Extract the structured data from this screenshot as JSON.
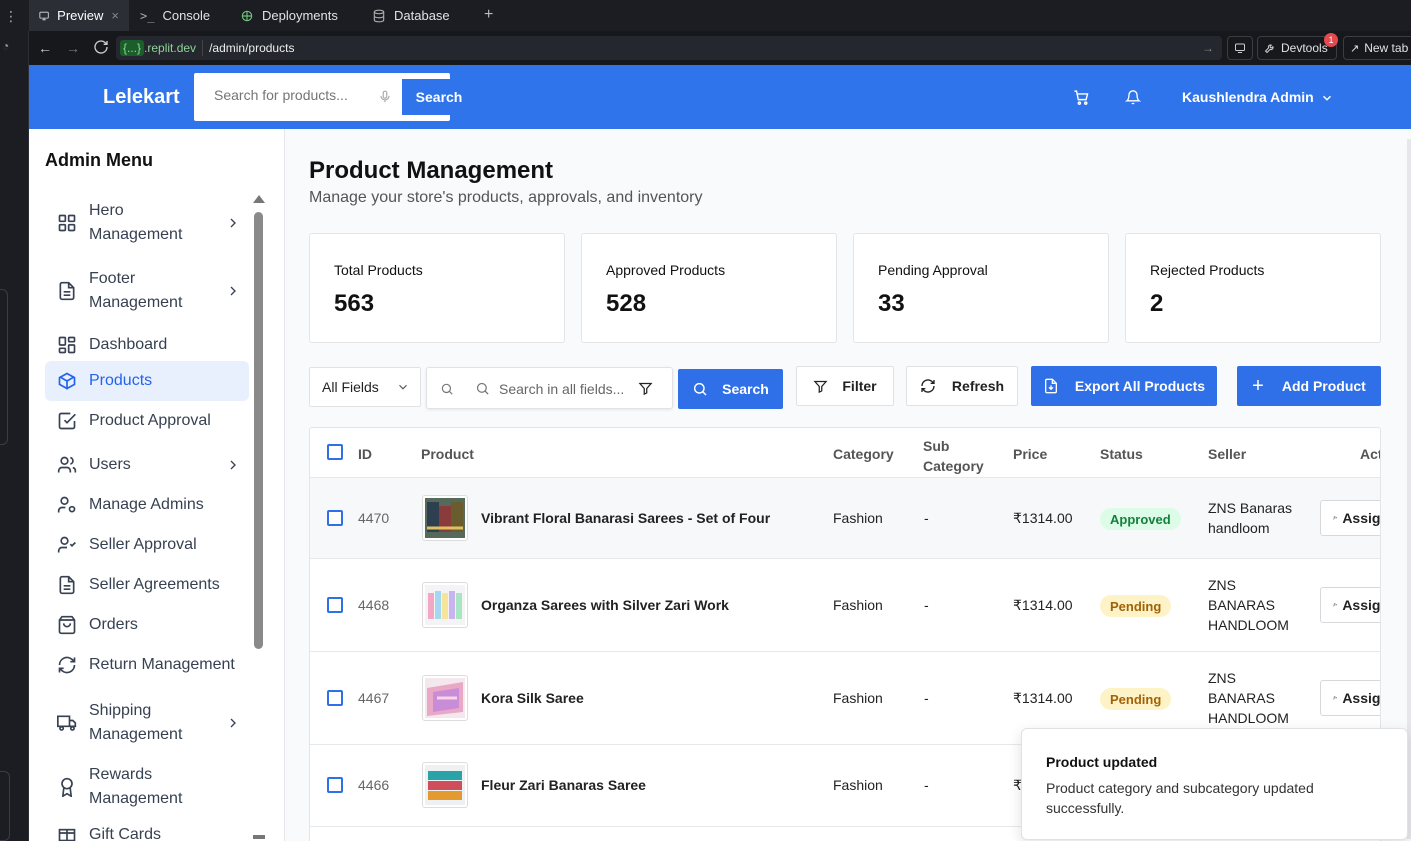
{
  "browser": {
    "tabs": [
      {
        "label": "Preview",
        "icon": "monitor-icon"
      },
      {
        "label": "Console",
        "icon": "terminal-icon"
      },
      {
        "label": "Deployments",
        "icon": "deploy-icon"
      },
      {
        "label": "Database",
        "icon": "database-icon"
      }
    ],
    "url_badge": "{...}",
    "url_domain": ".replit.dev",
    "url_path": "/admin/products",
    "devtools_label": "Devtools",
    "devtools_count": "1",
    "newtab_label": "New tab"
  },
  "header": {
    "brand": "Lelekart",
    "search_placeholder": "Search for products...",
    "search_button": "Search",
    "user_name": "Kaushlendra Admin"
  },
  "sidebar": {
    "title": "Admin Menu",
    "items": [
      {
        "label": "Hero Management",
        "icon": "grid-icon",
        "chevron": true
      },
      {
        "label": "Footer Management",
        "icon": "document-icon",
        "chevron": true
      },
      {
        "label": "Dashboard",
        "icon": "grid-icon",
        "chevron": false
      },
      {
        "label": "Products",
        "icon": "package-icon",
        "chevron": false,
        "active": true
      },
      {
        "label": "Product Approval",
        "icon": "check-square-icon",
        "chevron": false
      },
      {
        "label": "Users",
        "icon": "users-icon",
        "chevron": true
      },
      {
        "label": "Manage Admins",
        "icon": "user-cog-icon",
        "chevron": false
      },
      {
        "label": "Seller Approval",
        "icon": "user-check-icon",
        "chevron": false
      },
      {
        "label": "Seller Agreements",
        "icon": "document-icon",
        "chevron": false
      },
      {
        "label": "Orders",
        "icon": "shopping-bag-icon",
        "chevron": false
      },
      {
        "label": "Return Management",
        "icon": "refresh-icon",
        "chevron": false
      },
      {
        "label": "Shipping Management",
        "icon": "truck-icon",
        "chevron": true
      },
      {
        "label": "Rewards Management",
        "icon": "award-icon",
        "chevron": false
      },
      {
        "label": "Gift Cards",
        "icon": "gift-icon",
        "chevron": false
      }
    ]
  },
  "page": {
    "title": "Product Management",
    "subtitle": "Manage your store's products, approvals, and inventory"
  },
  "stats": [
    {
      "label": "Total Products",
      "value": "563"
    },
    {
      "label": "Approved Products",
      "value": "528"
    },
    {
      "label": "Pending Approval",
      "value": "33"
    },
    {
      "label": "Rejected Products",
      "value": "2"
    }
  ],
  "toolbar": {
    "field_select": "All Fields",
    "search_placeholder": "Search in all fields...",
    "search_button": "Search",
    "filter_button": "Filter",
    "refresh_button": "Refresh",
    "export_button": "Export All Products",
    "add_button": "Add Product"
  },
  "table": {
    "headers": {
      "id": "ID",
      "product": "Product",
      "category": "Category",
      "subcategory": "Sub Category",
      "price": "Price",
      "status": "Status",
      "seller": "Seller",
      "actions": "Actions"
    },
    "assign_label": "Assign",
    "rows": [
      {
        "id": "4470",
        "name": "Vibrant Floral Banarasi Sarees - Set of Four",
        "category": "Fashion",
        "subcategory": "-",
        "price": "₹1314.00",
        "status": "Approved",
        "seller": "ZNS Banaras handloom"
      },
      {
        "id": "4468",
        "name": "Organza Sarees with Silver Zari Work",
        "category": "Fashion",
        "subcategory": "-",
        "price": "₹1314.00",
        "status": "Pending",
        "seller": "ZNS BANARAS HANDLOOM"
      },
      {
        "id": "4467",
        "name": "Kora Silk Saree",
        "category": "Fashion",
        "subcategory": "-",
        "price": "₹1314.00",
        "status": "Pending",
        "seller": "ZNS BANARAS HANDLOOM"
      },
      {
        "id": "4466",
        "name": "Fleur Zari Banaras Saree",
        "category": "Fashion",
        "subcategory": "-",
        "price": "₹",
        "status": "",
        "seller": ""
      }
    ]
  },
  "toast": {
    "title": "Product updated",
    "message": "Product category and subcategory updated successfully."
  },
  "colors": {
    "primary": "#2f74ea",
    "approved_bg": "#dcfce7",
    "approved_text": "#15803d",
    "pending_bg": "#fef3c7",
    "pending_text": "#a16207"
  }
}
